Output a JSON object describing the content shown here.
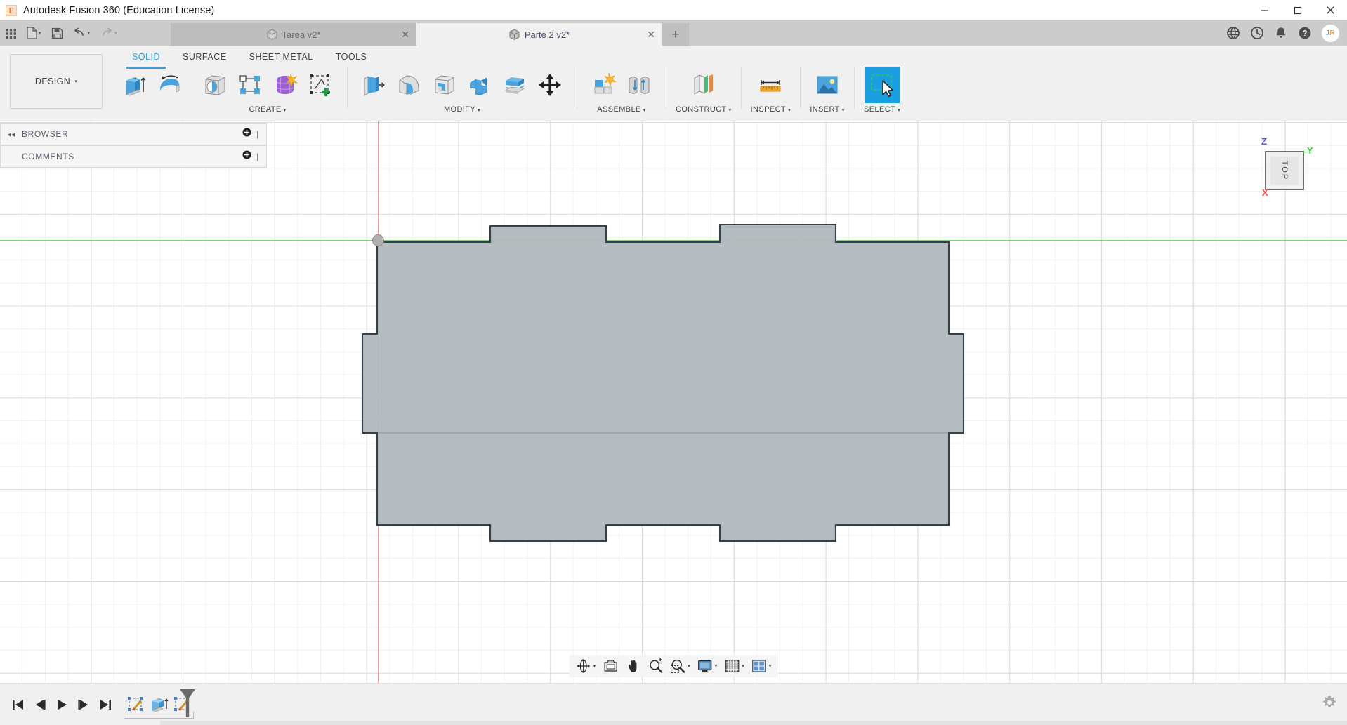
{
  "app": {
    "title": "Autodesk Fusion 360 (Education License)",
    "logo_letter": "F",
    "accent_color": "#3aa0dc",
    "select_highlight_color": "#1a9fe0"
  },
  "window_controls": [
    {
      "name": "minimize-button",
      "label": "—"
    },
    {
      "name": "maximize-button",
      "label": "❐"
    },
    {
      "name": "close-button",
      "label": "✕"
    }
  ],
  "quick_access": {
    "buttons": [
      {
        "name": "app-grid-button",
        "icon": "grid-apps-icon",
        "caret": false
      },
      {
        "name": "new-file-button",
        "icon": "file-icon",
        "caret": true
      },
      {
        "name": "save-button",
        "icon": "save-disk-icon",
        "caret": false
      },
      {
        "name": "undo-button",
        "icon": "undo-arrow-icon",
        "caret": true
      },
      {
        "name": "redo-button",
        "icon": "redo-arrow-icon",
        "caret": true
      }
    ],
    "caret_glyph": "▾",
    "new_tab_label": "+"
  },
  "document_tabs": [
    {
      "name": "tab-tarea",
      "label": "Tarea v2*",
      "active": false,
      "close_glyph": "✕"
    },
    {
      "name": "tab-parte-2",
      "label": "Parte 2 v2*",
      "active": true,
      "close_glyph": "✕"
    }
  ],
  "header_icons": [
    {
      "name": "globe-icon",
      "label": ""
    },
    {
      "name": "job-status-clock-icon",
      "label": ""
    },
    {
      "name": "notifications-bell-icon",
      "label": ""
    },
    {
      "name": "help-icon",
      "label": "?"
    }
  ],
  "avatar": {
    "name": "user-avatar",
    "initials": "JR",
    "first": "J",
    "second": "R"
  },
  "ribbon": {
    "workspace_button": {
      "label": "DESIGN",
      "caret": "▾"
    },
    "tabs": [
      {
        "name": "tab-solid",
        "label": "SOLID",
        "active": true
      },
      {
        "name": "tab-surface",
        "label": "SURFACE",
        "active": false
      },
      {
        "name": "tab-sheet-metal",
        "label": "SHEET METAL",
        "active": false
      },
      {
        "name": "tab-tools",
        "label": "TOOLS",
        "active": false
      }
    ],
    "caret": "▾",
    "panels": [
      {
        "name": "panel-create",
        "label": "CREATE",
        "has_caret": true,
        "commands": [
          {
            "name": "extrude-command",
            "icon": "extrude-icon"
          },
          {
            "name": "revolve-command",
            "icon": "revolve-icon"
          },
          {
            "name": "hole-command",
            "icon": "hole-icon"
          },
          {
            "name": "pattern-command",
            "icon": "rectangular-pattern-icon"
          },
          {
            "name": "form-command",
            "icon": "create-form-icon"
          },
          {
            "name": "create-sketch-command",
            "icon": "create-sketch-icon"
          }
        ]
      },
      {
        "name": "panel-modify",
        "label": "MODIFY",
        "has_caret": true,
        "commands": [
          {
            "name": "press-pull-command",
            "icon": "press-pull-icon"
          },
          {
            "name": "fillet-command",
            "icon": "fillet-icon"
          },
          {
            "name": "shell-command",
            "icon": "shell-icon"
          },
          {
            "name": "combine-command",
            "icon": "combine-icon"
          },
          {
            "name": "offset-face-command",
            "icon": "offset-face-icon"
          },
          {
            "name": "move-copy-command",
            "icon": "move-copy-icon"
          }
        ]
      },
      {
        "name": "panel-assemble",
        "label": "ASSEMBLE",
        "has_caret": true,
        "commands": [
          {
            "name": "new-component-command",
            "icon": "new-component-icon"
          },
          {
            "name": "joint-command",
            "icon": "joint-icon"
          }
        ]
      },
      {
        "name": "panel-construct",
        "label": "CONSTRUCT",
        "has_caret": true,
        "commands": [
          {
            "name": "construct-plane-command",
            "icon": "offset-plane-icon"
          }
        ]
      },
      {
        "name": "panel-inspect",
        "label": "INSPECT",
        "has_caret": true,
        "commands": [
          {
            "name": "measure-command",
            "icon": "measure-ruler-icon"
          }
        ]
      },
      {
        "name": "panel-insert",
        "label": "INSERT",
        "has_caret": true,
        "commands": [
          {
            "name": "insert-image-command",
            "icon": "insert-image-icon"
          }
        ]
      },
      {
        "name": "panel-select",
        "label": "SELECT",
        "has_caret": true,
        "commands": [
          {
            "name": "select-command",
            "icon": "select-cursor-icon",
            "selected": true
          }
        ]
      }
    ]
  },
  "side_panels": [
    {
      "name": "panel-browser",
      "label": "BROWSER",
      "collapse_glyph": "◂◂",
      "has_collapse": true
    },
    {
      "name": "panel-comments",
      "label": "COMMENTS",
      "collapse_glyph": "",
      "has_collapse": false
    }
  ],
  "viewcube": {
    "face_label": "TOP",
    "axes": [
      {
        "name": "axis-label-z",
        "label": "Z",
        "color": "#5a5ae0"
      },
      {
        "name": "axis-label-y",
        "label": "Y",
        "color": "#3fd13f"
      },
      {
        "name": "axis-label-x",
        "label": "X",
        "color": "#ef5a5a"
      }
    ]
  },
  "canvas": {
    "background": "#ffffff",
    "grid_fine_color": "#f0f0f0",
    "grid_major_color": "#dcdcdc",
    "x_axis_color": "#7ad17a",
    "y_axis_color": "#ef9b9b",
    "body_fill": "#aeb7bb",
    "body_stroke": "#33424a",
    "origin_label": "origin-point"
  },
  "navigation_bar": [
    {
      "name": "orbit-tool",
      "icon": "orbit-icon",
      "caret": true
    },
    {
      "name": "look-at-tool",
      "icon": "look-at-icon",
      "caret": false
    },
    {
      "name": "pan-tool",
      "icon": "pan-hand-icon",
      "caret": false
    },
    {
      "name": "zoom-tool",
      "icon": "zoom-magnifier-icon",
      "caret": false
    },
    {
      "name": "zoom-window-tool",
      "icon": "zoom-window-icon",
      "caret": true
    },
    {
      "name": "display-settings-tool",
      "icon": "display-monitor-icon",
      "caret": true
    },
    {
      "name": "grid-snaps-tool",
      "icon": "grid-icon",
      "caret": true
    },
    {
      "name": "viewports-tool",
      "icon": "viewports-icon",
      "caret": true
    }
  ],
  "timeline": {
    "playback": [
      {
        "name": "timeline-go-to-beginning",
        "icon": "skip-start-icon"
      },
      {
        "name": "timeline-step-back",
        "icon": "step-back-icon"
      },
      {
        "name": "timeline-play",
        "icon": "play-icon"
      },
      {
        "name": "timeline-step-forward",
        "icon": "step-forward-icon"
      },
      {
        "name": "timeline-go-to-end",
        "icon": "skip-end-icon"
      }
    ],
    "features": [
      {
        "name": "timeline-feature-sketch-1",
        "icon": "sketch-feature-icon"
      },
      {
        "name": "timeline-feature-extrude",
        "icon": "extrude-feature-icon"
      },
      {
        "name": "timeline-feature-sketch-2",
        "icon": "sketch-feature-icon"
      }
    ],
    "marker_name": "timeline-marker",
    "settings_name": "timeline-settings-gear"
  }
}
